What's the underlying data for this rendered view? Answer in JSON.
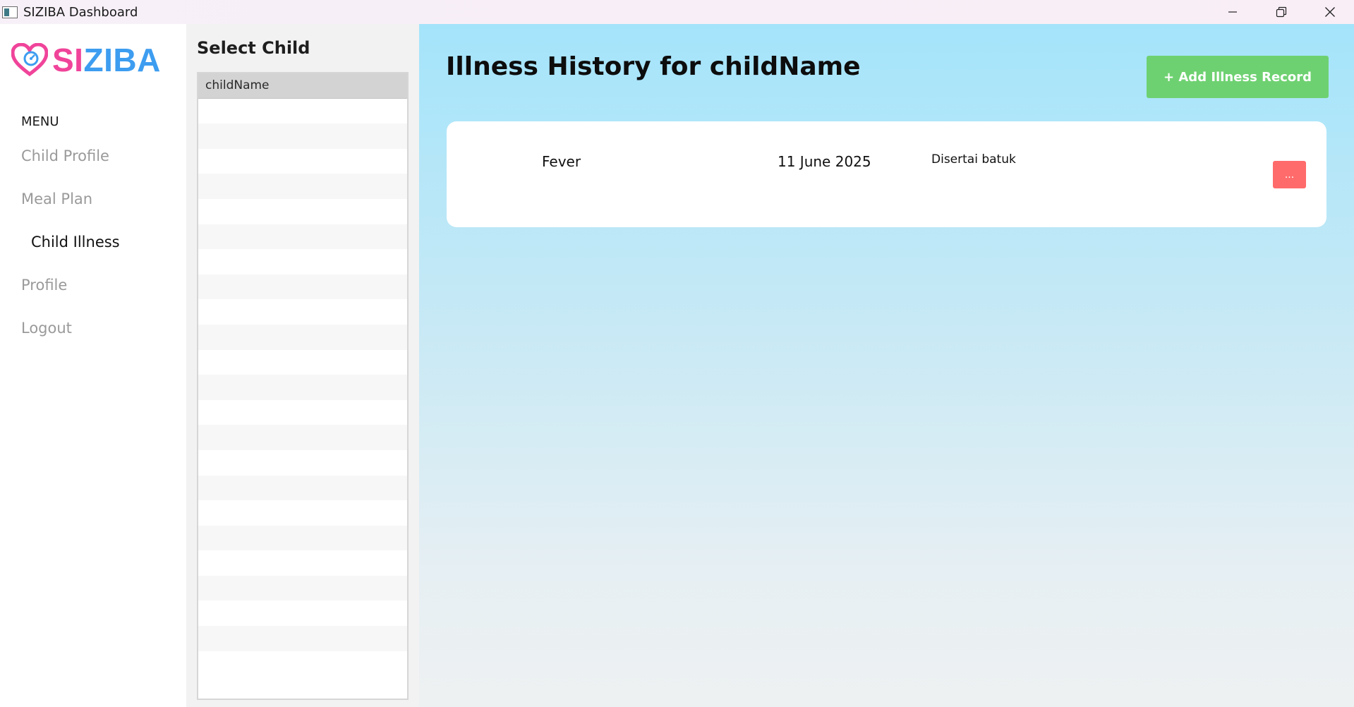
{
  "window": {
    "title": "SIZIBA Dashboard",
    "controls": [
      "minimize",
      "restore",
      "close"
    ]
  },
  "sidebar": {
    "logo": {
      "part1": "SI",
      "part2": "ZIBA",
      "colors": {
        "part1": "#f0449a",
        "part2": "#3d9df0"
      }
    },
    "menu_label": "MENU",
    "items": [
      {
        "label": "Child Profile",
        "active": false
      },
      {
        "label": "Meal Plan",
        "active": false
      },
      {
        "label": "Child Illness",
        "active": true
      },
      {
        "label": "Profile",
        "active": false
      },
      {
        "label": "Logout",
        "active": false
      }
    ]
  },
  "child_panel": {
    "title": "Select Child",
    "children": [
      "childName"
    ],
    "selected_index": 0
  },
  "main": {
    "title": "Illness History for childName",
    "add_button_label": "+ Add Illness Record",
    "records": [
      {
        "illness": "Fever",
        "date": "11 June 2025",
        "notes": "Disertai batuk",
        "menu_label": "..."
      }
    ]
  },
  "colors": {
    "accent_green": "#6ed171",
    "action_red": "#ff6b6b",
    "bg_top": "#a4e4fb"
  }
}
